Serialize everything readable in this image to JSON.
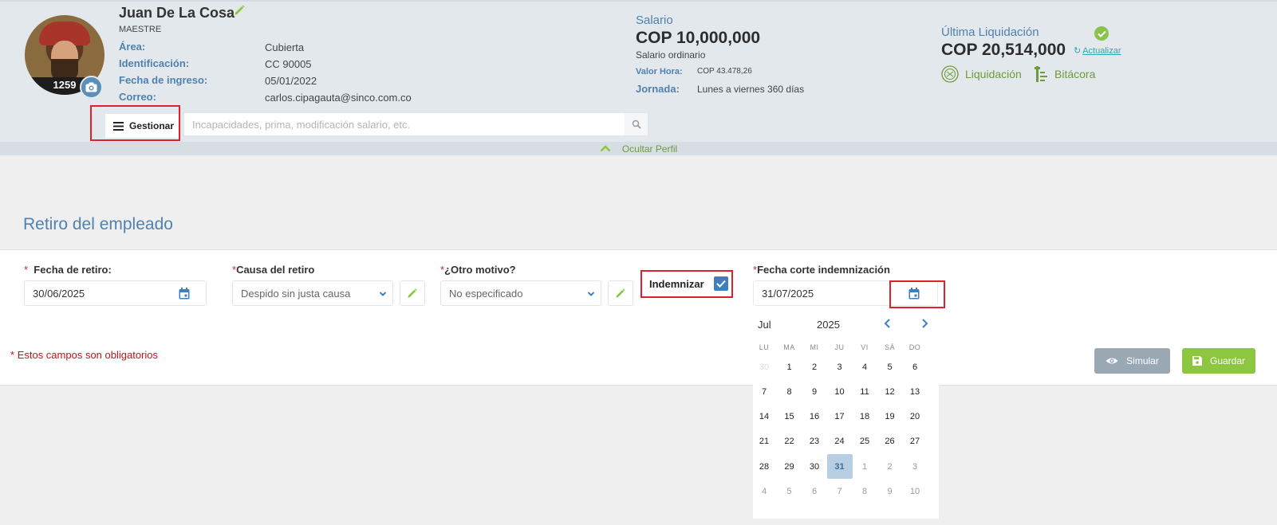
{
  "profile": {
    "employee_number": "1259",
    "name": "Juan De La Cosa",
    "role": "MAESTRE",
    "fields": [
      {
        "label": "Área:",
        "value": "Cubierta"
      },
      {
        "label": "Identificación:",
        "value": "CC 90005"
      },
      {
        "label": "Fecha de ingreso:",
        "value": "05/01/2022"
      },
      {
        "label": "Correo:",
        "value": "carlos.cipagauta@sinco.com.co"
      }
    ],
    "salary": {
      "label": "Salario",
      "value": "COP 10,000,000",
      "type": "Salario ordinario",
      "hour_label": "Valor Hora:",
      "hour_value": "COP 43.478,26",
      "jornada_label": "Jornada:",
      "jornada_value": "Lunes a viernes 360 días"
    },
    "last_settlement": {
      "label": "Última Liquidación",
      "value": "COP 20,514,000",
      "update_link": "Actualizar"
    },
    "actions": {
      "liquidacion": "Liquidación",
      "bitacora": "Bitácora"
    },
    "manage_button": "Gestionar",
    "search_placeholder": "Incapacidades, prima, modificación salario, etc.",
    "hide_profile": "Ocultar Perfil"
  },
  "page": {
    "title": "Retiro del empleado"
  },
  "form": {
    "fecha_retiro": {
      "label": "Fecha de retiro:",
      "value": "30/06/2025"
    },
    "causa_retiro": {
      "label": "Causa del retiro",
      "value": "Despido sin justa causa"
    },
    "otro_motivo": {
      "label": "¿Otro motivo?",
      "value": "No especificado"
    },
    "indemnizar": {
      "label": "Indemnizar",
      "checked": true
    },
    "fecha_corte": {
      "label": "Fecha corte indemnización",
      "value": "31/07/2025"
    },
    "required_note": "Estos campos son obligatorios",
    "required_mark": "*",
    "simular": "Simular",
    "guardar": "Guardar"
  },
  "calendar": {
    "month": "Jul",
    "year": "2025",
    "weekdays": [
      "LU",
      "MA",
      "MI",
      "JU",
      "VI",
      "SÁ",
      "DO"
    ],
    "weeks": [
      [
        "30",
        "1",
        "2",
        "3",
        "4",
        "5",
        "6"
      ],
      [
        "7",
        "8",
        "9",
        "10",
        "11",
        "12",
        "13"
      ],
      [
        "14",
        "15",
        "16",
        "17",
        "18",
        "19",
        "20"
      ],
      [
        "21",
        "22",
        "23",
        "24",
        "25",
        "26",
        "27"
      ],
      [
        "28",
        "29",
        "30",
        "31",
        "1",
        "2",
        "3"
      ],
      [
        "4",
        "5",
        "6",
        "7",
        "8",
        "9",
        "10"
      ]
    ],
    "selected": "31"
  },
  "colors": {
    "accent_blue": "#4f82b0",
    "accent_green": "#8dc63f",
    "required_red": "#c80f1c",
    "highlight_box": "#e0202a"
  }
}
